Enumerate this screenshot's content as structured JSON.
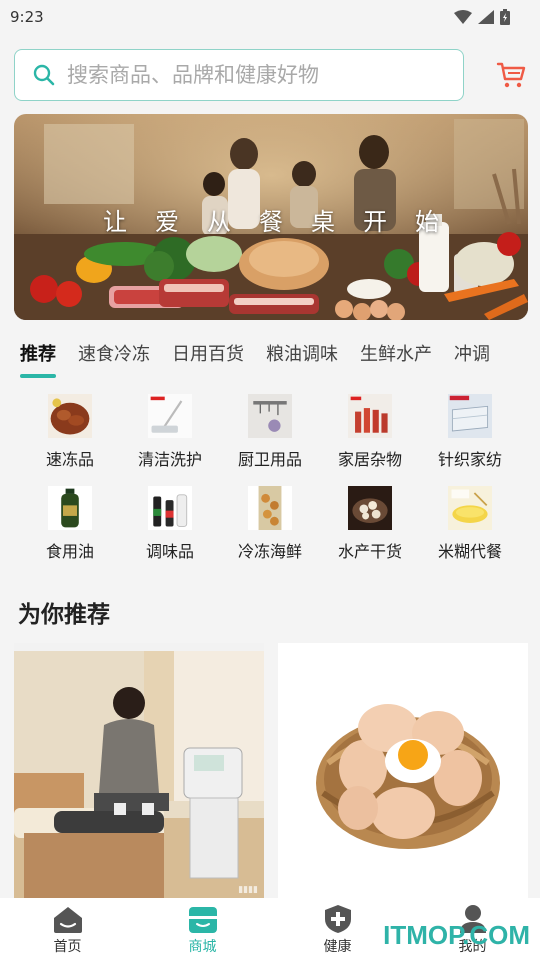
{
  "status_bar": {
    "time": "9:23"
  },
  "search": {
    "placeholder": "搜索商品、品牌和健康好物"
  },
  "banner": {
    "text": "让爱从餐桌开始"
  },
  "tabs": [
    {
      "label": "推荐",
      "active": true
    },
    {
      "label": "速食冷冻"
    },
    {
      "label": "日用百货"
    },
    {
      "label": "粮油调味"
    },
    {
      "label": "生鲜水产"
    },
    {
      "label": "冲调"
    }
  ],
  "categories": [
    {
      "label": "速冻品",
      "icon": "frozen-food-image"
    },
    {
      "label": "清洁洗护",
      "icon": "mop-image"
    },
    {
      "label": "厨卫用品",
      "icon": "kitchen-hook-image"
    },
    {
      "label": "家居杂物",
      "icon": "bottles-image"
    },
    {
      "label": "针织家纺",
      "icon": "mattress-image"
    },
    {
      "label": "食用油",
      "icon": "oil-bottle-image"
    },
    {
      "label": "调味品",
      "icon": "sauce-bottles-image"
    },
    {
      "label": "冷冻海鲜",
      "icon": "seafood-image"
    },
    {
      "label": "水产干货",
      "icon": "dried-goods-image"
    },
    {
      "label": "米糊代餐",
      "icon": "rice-paste-image"
    }
  ],
  "section": {
    "title": "为你推荐"
  },
  "recommend": [
    {
      "image": "physiotherapy-device-image"
    },
    {
      "image": "egg-basket-image"
    }
  ],
  "bottom_nav": [
    {
      "label": "首页",
      "icon": "home-icon"
    },
    {
      "label": "商城",
      "icon": "store-icon",
      "active": true
    },
    {
      "label": "健康",
      "icon": "health-shield-icon"
    },
    {
      "label": "我的",
      "icon": "profile-icon"
    }
  ],
  "watermark": {
    "text": "ITMOP.COM"
  },
  "colors": {
    "accent": "#2bb6a7",
    "cart": "#ef5a45"
  }
}
